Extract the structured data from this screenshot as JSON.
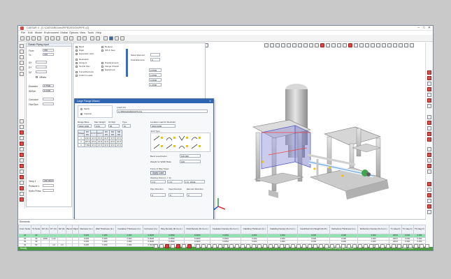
{
  "window": {
    "title": "CAESAR II - [C:\\CAESARIIJobs\\PIPEDESIGN\\PIPE.c2]",
    "minimize": "–",
    "maximize": "□",
    "close": "✕"
  },
  "menu": [
    "File",
    "Edit",
    "Model",
    "Environment",
    "Global",
    "Options",
    "View",
    "Tools",
    "Help"
  ],
  "panel": {
    "title": "Classic Piping Input",
    "from_label": "From",
    "from_value": "180",
    "to_label": "To",
    "to_value": "190",
    "dx_label": "DX",
    "dy_label": "DY",
    "dz_label": "DZ",
    "offsets_label": "Offsets",
    "diameter_label": "Diameter",
    "diameter_value": "6.7500",
    "wt_label": "Wt/Sch",
    "wt_value": "0.1340",
    "corrosion_label": "Corrosion",
    "fluid_label": "Fluid Den",
    "temp_label": "Temp 1",
    "temp_value": "180.0000",
    "pressure_label": "Pressure 1",
    "hydro_label": "Hydro Press",
    "checks": [
      "Bend",
      "Rigid",
      "Expansion Joint",
      "Restraints",
      "Hangers",
      "Nozzle Flex",
      "Displacements",
      "Force/Moments",
      "Uniform Loads",
      "Wind/Wave",
      "Offsets",
      "Allowable Stress",
      "SIF & Tees",
      "Flange Checks",
      "Reducer",
      "Equipment"
    ],
    "sif_label": "Select Element",
    "total_elements_label": "Total Elements",
    "total_elements_value": "9",
    "sif_panel_values": [
      "0.2500",
      "0.3560",
      "0.4500",
      "1.2500"
    ]
  },
  "dialog": {
    "title": "Large Flange Wizard",
    "close": "✕",
    "metric_label": "Metric",
    "imperial_label": "Imperial",
    "load_unit_label": "Load Unit",
    "load_unit_value": "C:\\PROGRAM\\UNITS.FIL",
    "range_label": "Range Base",
    "range_value": "0000 1000",
    "weight_header": "Weight Rule",
    "weight_cols": [
      "Label",
      "Max Weight",
      "Kit Wgt",
      "Type"
    ],
    "weight_values": [
      "0.00",
      "96",
      "ID"
    ],
    "matrix_headers": [
      "Shape",
      "RX RS",
      "FY FT",
      "FZ FT",
      "RX RS",
      "MX MS",
      "MZ MS"
    ],
    "matrix_rows": [
      [
        "1",
        "240.0",
        "97.8",
        "97.8",
        "97.8",
        "97.8",
        "97.8"
      ],
      [
        "2",
        "167.9",
        "97.8",
        "97.8",
        "97.8",
        "97.8",
        "97.8"
      ],
      [
        "3",
        "7.594",
        "97.8",
        "97.8",
        "97.8",
        "97.8",
        "97.8"
      ]
    ],
    "location_label": "Location Load for Restraint",
    "location_value": "2000 2000",
    "joint_type_label": "Joint Type",
    "bend_factor_label": "Bend Load Factor",
    "bend_factor_value": "100.000",
    "weight_units_label": "Weight for Width Ratio",
    "weight_units_value": "100",
    "force_label": "Force of Rise Tower",
    "force_button": "Apply Load",
    "working_label": "Working Point (x, Y, Z)",
    "working_values": [
      "1 Ft.",
      "1 Ft.",
      "1 Ft. Z2CE"
    ],
    "pipe_label": "Pipe Direction",
    "view_label": "View Direction",
    "element_label": "Element Direction",
    "pipe_value": "0",
    "view_value": "0",
    "element_value": "0",
    "accept": "Accept",
    "cancel": "Cancel"
  },
  "bottom_panel": {
    "title": "Elements",
    "headers": [
      "From Node",
      "To Node",
      "DX (ft.)",
      "DY (ft.)",
      "DZ (ft.)",
      "Bend",
      "Rigid",
      "Diameter (in.)",
      "Wall Thickness (in.)",
      "Insulation Thickness (in.)",
      "Corrosion (in.)",
      "Pipe Density (lb./cu.in.)",
      "Fluid Density (lb./cu.in.)",
      "Insulation Density (lb./cu.in.)",
      "Cladding Thickness (in.)",
      "Cladding Density (lb./cu.in.)",
      "Insul/Clad Unit Weight (lb./ft.)",
      "Refractory Thickness (in.)",
      "Refractory Density (lb./cu.in.)",
      "T1 (deg F)",
      "T2 (deg F)",
      "T3 (deg F)"
    ],
    "rows": [
      [
        "10",
        "20",
        "",
        "",
        "",
        "",
        "",
        "6.625",
        "0.280",
        "2.000",
        "0.0625",
        "0.2830",
        "0.0360",
        "0.0064",
        "0.000",
        "0.000",
        "0.000",
        "0.000",
        "0.000",
        "180.0",
        "0.000",
        "0.000"
      ],
      [
        "20",
        "30",
        "2000",
        "1.00",
        "",
        "",
        "",
        "6.625",
        "0.280",
        "2.000",
        "0.0625",
        "0.2830",
        "0.0360",
        "0.0064",
        "0.000",
        "0.000",
        "0.000",
        "0.000",
        "0.000",
        "180.0",
        "0.000",
        "0.000"
      ],
      [
        "30",
        "40",
        "",
        "",
        "",
        "",
        "",
        "6.625",
        "0.280",
        "2.000",
        "0.0625",
        "0.2830",
        "0.0360",
        "0.0064",
        "0.000",
        "0.000",
        "0.000",
        "0.000",
        "0.000",
        "180.0",
        "0.000",
        "0.000"
      ],
      [
        "40",
        "50",
        "",
        "-1.0",
        "1.0",
        "",
        "",
        "6.625",
        "0.280",
        "2.000",
        "0.0625",
        "0.2830",
        "0.0360",
        "0.0064",
        "0.000",
        "0.000",
        "0.000",
        "0.000",
        "0.000",
        "180.0",
        "0.000",
        "0.000"
      ],
      [
        "50",
        "60",
        "",
        "",
        "",
        "",
        "",
        "6.625",
        "0.280",
        "2.000",
        "0.0625",
        "0.2830",
        "0.0360",
        "0.0064",
        "0.000",
        "0.000",
        "0.000",
        "0.000",
        "0.000",
        "180.0",
        "0.000",
        "0.000"
      ]
    ]
  },
  "status": {
    "left": "Ready",
    "right": "Errors: Check(F1) Units: Ext",
    "coords": "1000 - 1000"
  },
  "colors": {
    "accent": "#2f66b3",
    "status": "#4a9a3e",
    "selected_row": "#8fe3b0",
    "vessel": "#c9c9c9",
    "highlight_box": "#8b8fd8"
  }
}
